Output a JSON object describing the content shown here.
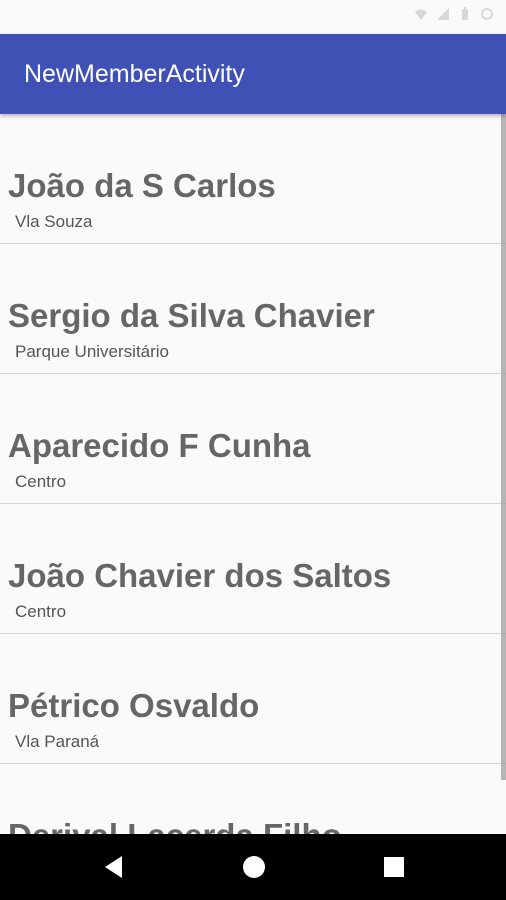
{
  "app_bar": {
    "title": "NewMemberActivity",
    "color": "#3f51b5"
  },
  "status_bar": {
    "icons": [
      "wifi-icon",
      "signal-icon",
      "battery-icon",
      "clock-icon"
    ]
  },
  "members": [
    {
      "name": "João da S Carlos",
      "neighborhood": "Vla Souza"
    },
    {
      "name": "Sergio da Silva Chavier",
      "neighborhood": "Parque Universitário"
    },
    {
      "name": "Aparecido F Cunha",
      "neighborhood": "Centro"
    },
    {
      "name": "João Chavier dos Saltos",
      "neighborhood": "Centro"
    },
    {
      "name": "Pétrico Osvaldo",
      "neighborhood": "Vla Paraná"
    },
    {
      "name": "Derival Lacerda Filho",
      "neighborhood": ""
    }
  ],
  "nav_bar": {
    "icons": [
      "back-icon",
      "home-icon",
      "recents-icon"
    ]
  }
}
